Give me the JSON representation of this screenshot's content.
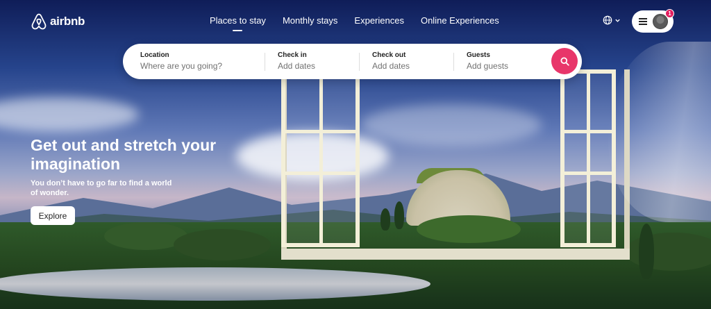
{
  "brand": {
    "name": "airbnb",
    "accent": "#e8366a"
  },
  "nav": {
    "items": [
      {
        "label": "Places to stay",
        "active": true
      },
      {
        "label": "Monthly stays",
        "active": false
      },
      {
        "label": "Experiences",
        "active": false
      },
      {
        "label": "Online Experiences",
        "active": false
      }
    ]
  },
  "header": {
    "notification_count": "1"
  },
  "search": {
    "location": {
      "label": "Location",
      "placeholder": "Where are you going?"
    },
    "checkin": {
      "label": "Check in",
      "placeholder": "Add dates"
    },
    "checkout": {
      "label": "Check out",
      "placeholder": "Add dates"
    },
    "guests": {
      "label": "Guests",
      "placeholder": "Add guests"
    }
  },
  "hero": {
    "title": "Get out and stretch your imagination",
    "subtitle": "You don’t have to go far to find a world of wonder.",
    "cta": "Explore"
  }
}
